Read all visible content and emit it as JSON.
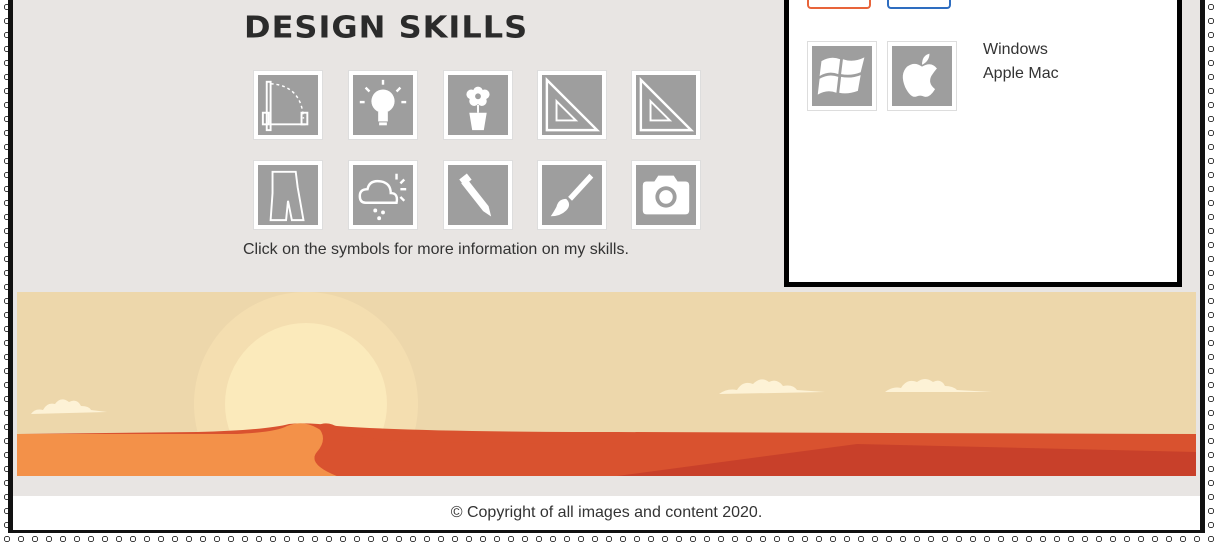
{
  "skills": {
    "title": "Design Skills",
    "note": "Click on the symbols for more information on my skills.",
    "icons": [
      "door-icon",
      "lightbulb-icon",
      "flower-pot-icon",
      "set-square-icon",
      "set-square-icon",
      "garment-pattern-icon",
      "weather-icon",
      "pencil-icon",
      "paintbrush-icon",
      "camera-icon"
    ]
  },
  "sidebar": {
    "os_labels": [
      "Windows",
      "Apple Mac"
    ],
    "os_icons": [
      "windows-icon",
      "apple-icon"
    ],
    "partial_tile_colors": [
      "#e8643a",
      "#2e6dc0"
    ]
  },
  "footer": {
    "copyright": "© Copyright of all images and content 2020."
  },
  "colors": {
    "page_bg": "#e8e5e3",
    "icon_bg": "#9e9e9e",
    "sky": "#edd7ab",
    "sun": "#fbeabb",
    "dune_orange": "#f39149",
    "dune_red": "#d9522f"
  }
}
